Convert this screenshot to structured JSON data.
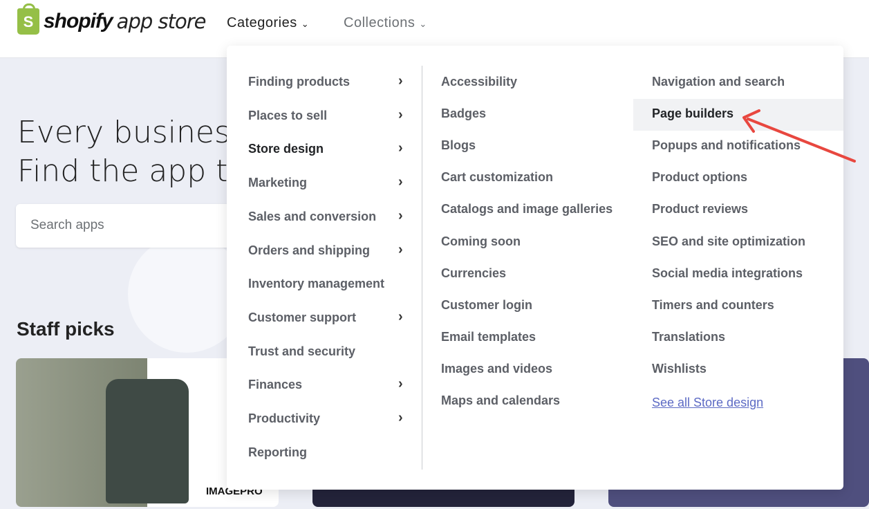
{
  "header": {
    "logo_brand": "shopify",
    "logo_suffix": "app store",
    "nav": [
      {
        "label": "Categories"
      },
      {
        "label": "Collections"
      }
    ]
  },
  "hero": {
    "line1": "Every business",
    "line2": "Find the app th"
  },
  "search": {
    "placeholder": "Search apps"
  },
  "staff_picks": {
    "title": "Staff picks",
    "card1_brand": "IMAGEPRO"
  },
  "menu": {
    "categories": [
      {
        "label": "Finding products",
        "has_sub": true
      },
      {
        "label": "Places to sell",
        "has_sub": true
      },
      {
        "label": "Store design",
        "has_sub": true,
        "active": true
      },
      {
        "label": "Marketing",
        "has_sub": true
      },
      {
        "label": "Sales and conversion",
        "has_sub": true
      },
      {
        "label": "Orders and shipping",
        "has_sub": true
      },
      {
        "label": "Inventory management",
        "has_sub": false
      },
      {
        "label": "Customer support",
        "has_sub": true
      },
      {
        "label": "Trust and security",
        "has_sub": false
      },
      {
        "label": "Finances",
        "has_sub": true
      },
      {
        "label": "Productivity",
        "has_sub": true
      },
      {
        "label": "Reporting",
        "has_sub": false
      }
    ],
    "sub_col1": [
      "Accessibility",
      "Badges",
      "Blogs",
      "Cart customization",
      "Catalogs and image galleries",
      "Coming soon",
      "Currencies",
      "Customer login",
      "Email templates",
      "Images and videos",
      "Maps and calendars"
    ],
    "sub_col2": [
      "Navigation and search",
      "Page builders",
      "Popups and notifications",
      "Product options",
      "Product reviews",
      "SEO and site optimization",
      "Social media integrations",
      "Timers and counters",
      "Translations",
      "Wishlists"
    ],
    "see_all": "See all Store design",
    "highlighted": "Page builders"
  },
  "colors": {
    "brand_green": "#95bf47",
    "link": "#5c6ac4",
    "annotation_arrow": "#e8473f"
  }
}
